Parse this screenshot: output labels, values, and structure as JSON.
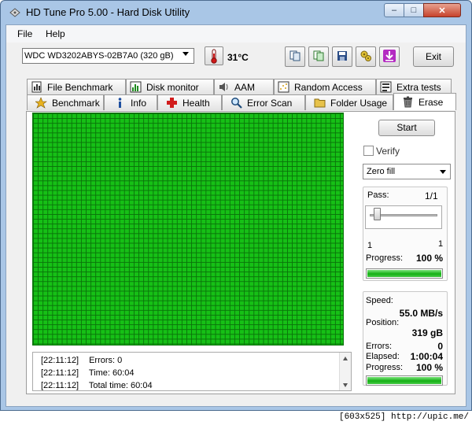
{
  "window": {
    "title": "HD Tune Pro 5.00 - Hard Disk Utility"
  },
  "caption_buttons": {
    "minimize": "–",
    "maximize": "□",
    "close": "✕"
  },
  "menu": {
    "file": "File",
    "help": "Help"
  },
  "toolbar": {
    "drive": "WDC WD3202ABYS-02B7A0 (320 gB)",
    "temperature": "31°C",
    "exit_label": "Exit",
    "icons": [
      "copy-text-icon",
      "copy-screenshot-icon",
      "save-icon",
      "options-icon",
      "download-icon"
    ]
  },
  "tabs": {
    "top": [
      {
        "label": "File Benchmark",
        "icon": "file-benchmark-icon"
      },
      {
        "label": "Disk monitor",
        "icon": "disk-monitor-icon"
      },
      {
        "label": "AAM",
        "icon": "speaker-icon"
      },
      {
        "label": "Random Access",
        "icon": "random-access-icon"
      },
      {
        "label": "Extra tests",
        "icon": "extra-tests-icon"
      }
    ],
    "bottom": [
      {
        "label": "Benchmark",
        "icon": "benchmark-icon"
      },
      {
        "label": "Info",
        "icon": "info-icon"
      },
      {
        "label": "Health",
        "icon": "health-icon"
      },
      {
        "label": "Error Scan",
        "icon": "magnifier-icon"
      },
      {
        "label": "Folder Usage",
        "icon": "folder-icon"
      },
      {
        "label": "Erase",
        "icon": "trash-icon"
      }
    ],
    "active": "Erase"
  },
  "erase": {
    "start_label": "Start",
    "verify_label": "Verify",
    "verify_checked": false,
    "mode": "Zero fill",
    "pass_label": "Pass:",
    "pass_value": "1/1",
    "slider_min": "1",
    "slider_max": "1",
    "progress_label": "Progress:",
    "progress_value": "100 %",
    "progress_fraction": 1.0,
    "speed_label": "Speed:",
    "speed_value": "55.0 MB/s",
    "position_label": "Position:",
    "position_value": "319 gB",
    "errors_label": "Errors:",
    "errors_value": "0",
    "elapsed_label": "Elapsed:",
    "elapsed_value": "1:00:04",
    "progress2_label": "Progress:",
    "progress2_value": "100 %",
    "progress2_fraction": 1.0
  },
  "log": [
    {
      "time": "[22:11:12]",
      "text": "Errors: 0"
    },
    {
      "time": "[22:11:12]",
      "text": "Time: 60:04"
    },
    {
      "time": "[22:11:12]",
      "text": "Total time: 60:04"
    }
  ],
  "colors": {
    "block_ok": "#16c016",
    "grid_line": "#0a740a",
    "progress": "#15b015"
  },
  "footer": "[603x525] http://upic.me/"
}
